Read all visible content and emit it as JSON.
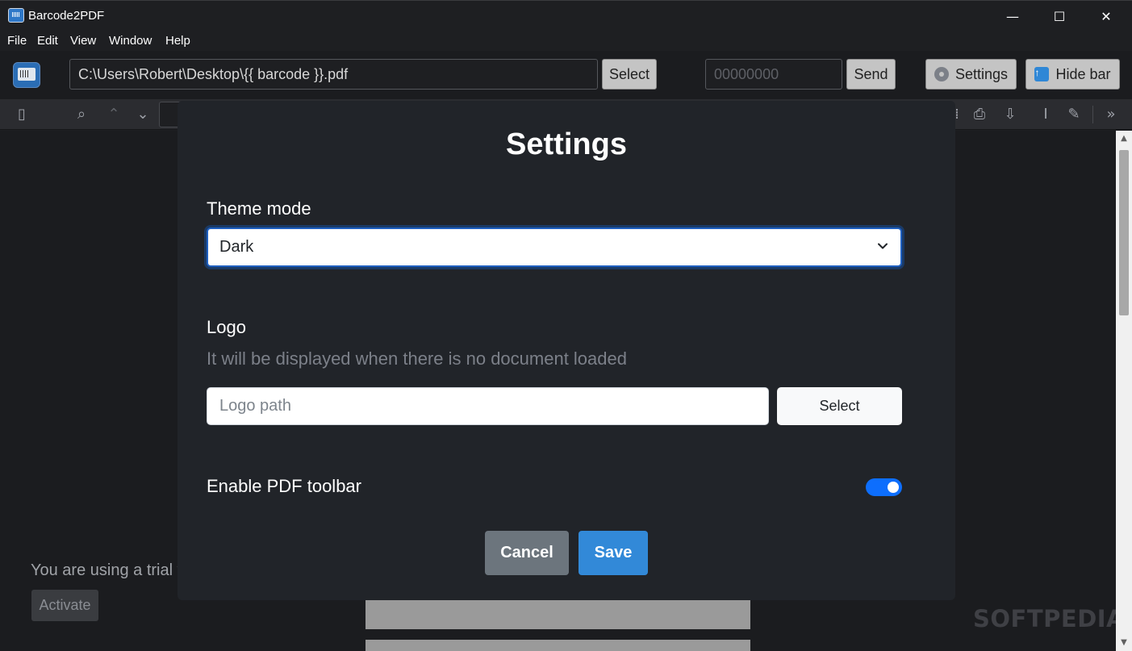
{
  "window": {
    "title": "Barcode2PDF",
    "minimize_glyph": "—",
    "maximize_glyph": "☐",
    "close_glyph": "✕"
  },
  "menu": [
    "File",
    "Edit",
    "View",
    "Window",
    "Help"
  ],
  "topbar": {
    "path_value": "C:\\Users\\Robert\\Desktop\\{{ barcode }}.pdf",
    "path_select_label": "Select",
    "code_placeholder": "00000000",
    "send_label": "Send",
    "settings_label": "Settings",
    "hide_bar_label": "Hide bar"
  },
  "pdf_toolbar": {
    "icons": [
      "sidebar-toggle-icon",
      "search-icon",
      "chevron-up-icon",
      "chevron-down-icon",
      "presentation-icon",
      "print-icon",
      "download-icon",
      "text-cursor-icon",
      "pen-icon",
      "double-chevron-right-icon"
    ]
  },
  "viewer": {
    "trial_text": "You are using a trial v",
    "activate_label": "Activate",
    "watermark": "SOFTPEDIA®"
  },
  "settings_modal": {
    "title": "Settings",
    "theme_label": "Theme mode",
    "theme_value": "Dark",
    "logo_label": "Logo",
    "logo_help": "It will be displayed when there is no document loaded",
    "logo_placeholder": "Logo path",
    "logo_select_label": "Select",
    "toolbar_toggle_label": "Enable PDF toolbar",
    "toolbar_enabled": true,
    "cancel_label": "Cancel",
    "save_label": "Save"
  },
  "colors": {
    "accent": "#0d6efd",
    "save_button": "#3289d8",
    "cancel_button": "#6c757d",
    "modal_bg": "#212429",
    "app_bg": "#1b1c1f"
  }
}
